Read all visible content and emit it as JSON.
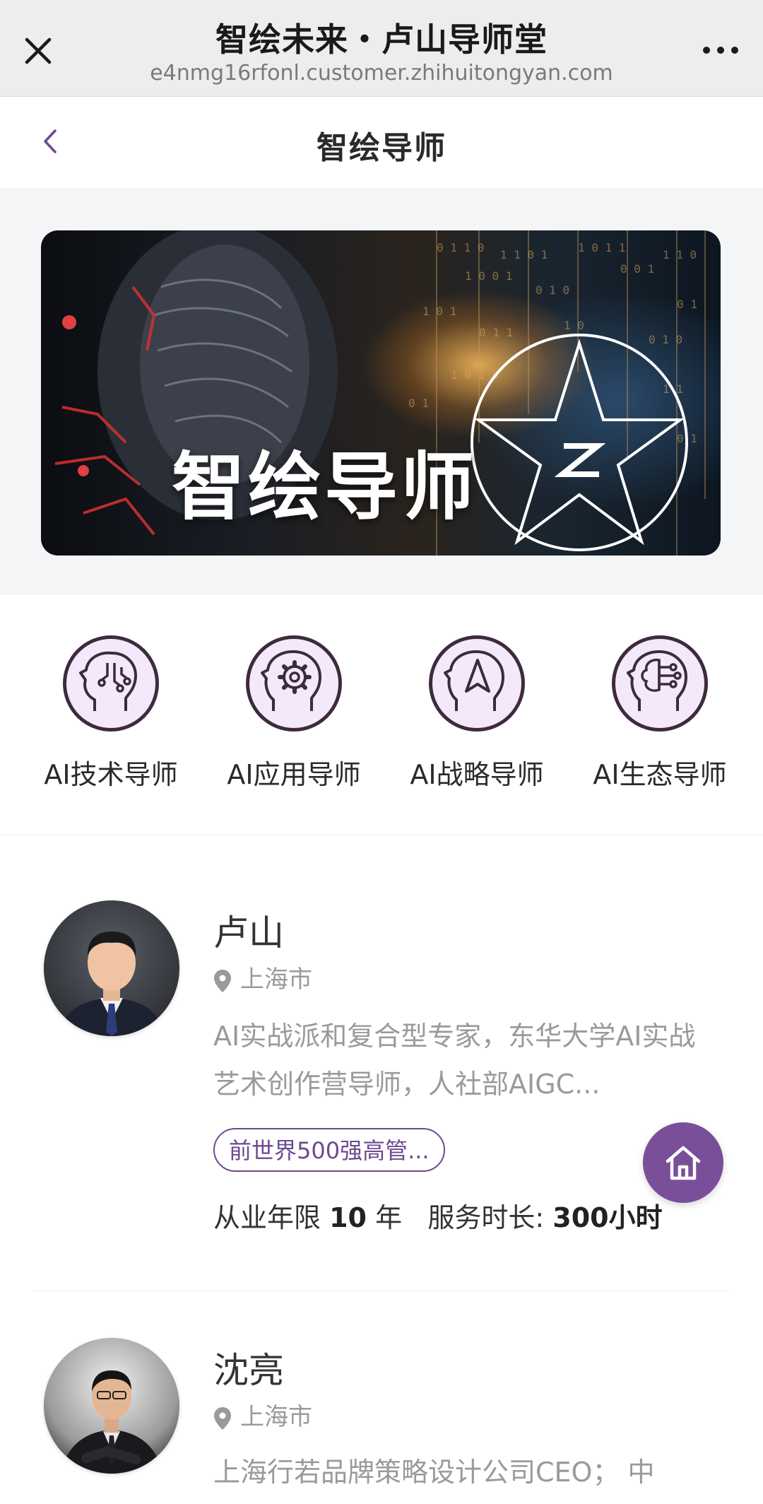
{
  "wechat_bar": {
    "title": "智绘未来・卢山导师堂",
    "url": "e4nmg16rfonl.customer.zhihuitongyan.com",
    "close_icon": "close-icon",
    "more_icon": "more-icon"
  },
  "header": {
    "title": "智绘导师",
    "back_icon": "chevron-left-icon"
  },
  "banner": {
    "text": "智绘导师",
    "logo_icon": "z-star-logo"
  },
  "categories": [
    {
      "label": "AI技术导师",
      "icon": "head-circuit-icon"
    },
    {
      "label": "AI应用导师",
      "icon": "head-gear-icon"
    },
    {
      "label": "AI战略导师",
      "icon": "head-compass-icon"
    },
    {
      "label": "AI生态导师",
      "icon": "head-brain-icon"
    }
  ],
  "mentors": [
    {
      "name": "卢山",
      "location": "上海市",
      "description": "AI实战派和复合型专家，东华大学AI实战艺术创作营导师，人社部AIGC...",
      "tag": "前世界500强高管...",
      "years_label": "从业年限",
      "years_value": "10",
      "years_unit": "年",
      "hours_label": "服务时长:",
      "hours_value": "300小时"
    },
    {
      "name": "沈亮",
      "location": "上海市",
      "description": "上海行若品牌策略设计公司CEO； 中"
    }
  ],
  "fab": {
    "icon": "home-icon"
  },
  "colors": {
    "accent": "#7a4f9a",
    "icon_bg": "#f3e9fb",
    "icon_stroke": "#3d2b3d"
  }
}
